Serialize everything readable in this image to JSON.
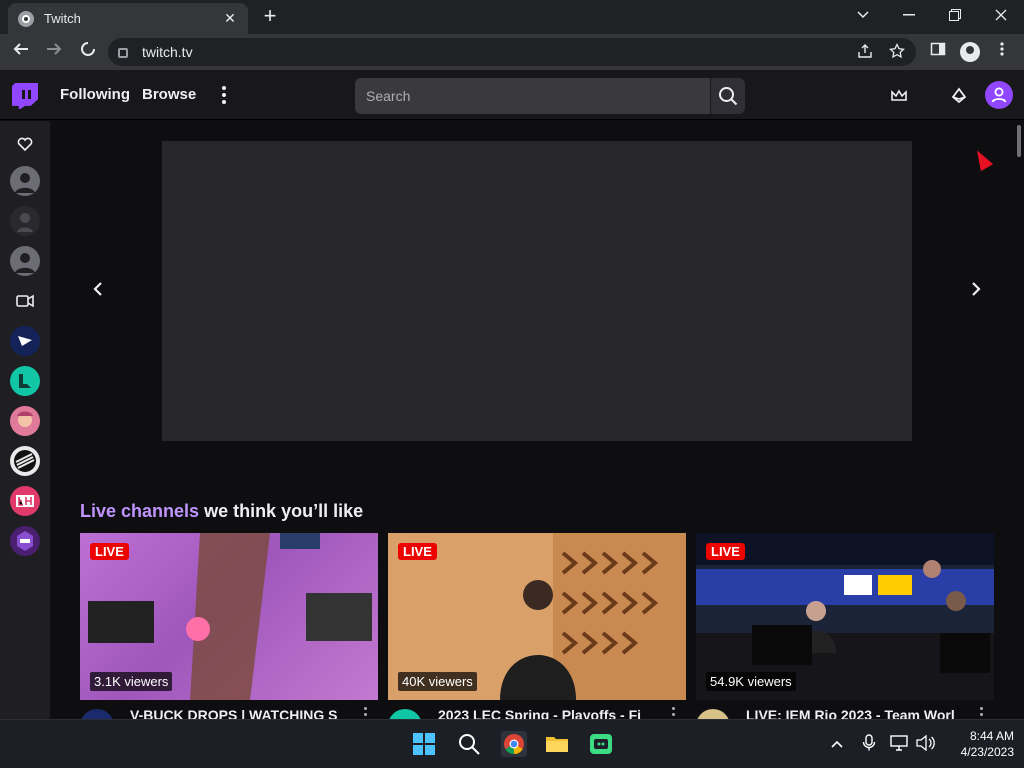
{
  "browser": {
    "tab_title": "Twitch",
    "url": "twitch.tv",
    "new_tab_symbol": "+",
    "close_symbol": "✕"
  },
  "twitch_nav": {
    "following": "Following",
    "browse": "Browse",
    "search_placeholder": "Search"
  },
  "sidebar": {
    "items": [
      {
        "icon": "heart-icon"
      },
      {
        "icon": "avatar-default"
      },
      {
        "icon": "avatar-dark"
      },
      {
        "icon": "avatar-default"
      },
      {
        "icon": "camera-icon"
      },
      {
        "icon": "channel-avatar"
      },
      {
        "icon": "channel-avatar"
      },
      {
        "icon": "channel-avatar"
      },
      {
        "icon": "channel-avatar"
      },
      {
        "icon": "channel-avatar"
      },
      {
        "icon": "channel-avatar"
      }
    ]
  },
  "section": {
    "title_highlight": "Live channels",
    "title_rest": " we think you’ll like"
  },
  "cards": [
    {
      "live": "LIVE",
      "viewers": "3.1K viewers",
      "title": "V-BUCK DROPS | WATCHING S",
      "thumb_color": "#b364c8",
      "avatar_color": "#1a2a6c"
    },
    {
      "live": "LIVE",
      "viewers": "40K viewers",
      "title": "2023 LEC Spring - Playoffs - Fi",
      "thumb_color": "#d39a62",
      "avatar_color": "#11c6a5"
    },
    {
      "live": "LIVE",
      "viewers": "54.9K viewers",
      "title": "LIVE: IEM Rio 2023 - Team Worl",
      "thumb_color": "#1e2640",
      "avatar_color": "#d8c089"
    }
  ],
  "taskbar": {
    "time": "8:44 AM",
    "date": "4/23/2023"
  },
  "colors": {
    "twitch_purple": "#9147ff",
    "highlight": "#bf94ff",
    "live_red": "#eb0400"
  }
}
